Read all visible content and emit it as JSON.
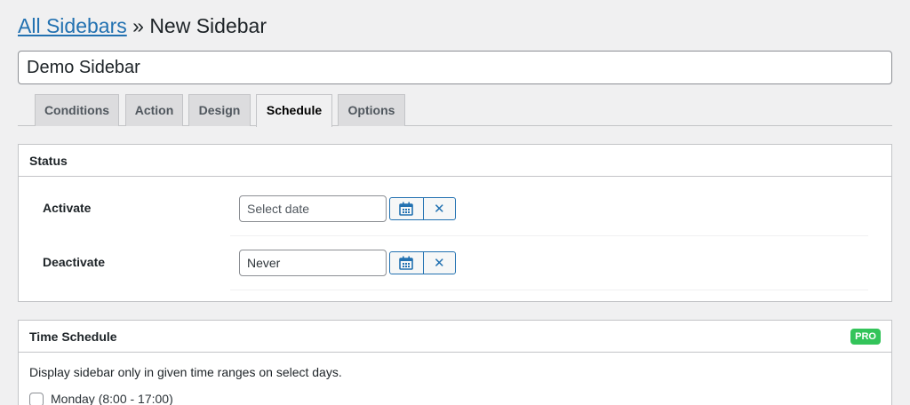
{
  "breadcrumb": {
    "link_label": "All Sidebars",
    "separator": "»",
    "current": "New Sidebar"
  },
  "title_input": {
    "value": "Demo Sidebar"
  },
  "tabs": [
    {
      "label": "Conditions",
      "active": false
    },
    {
      "label": "Action",
      "active": false
    },
    {
      "label": "Design",
      "active": false
    },
    {
      "label": "Schedule",
      "active": true
    },
    {
      "label": "Options",
      "active": false
    }
  ],
  "status_panel": {
    "title": "Status",
    "rows": [
      {
        "label": "Activate",
        "input_value": "",
        "placeholder": "Select date"
      },
      {
        "label": "Deactivate",
        "input_value": "Never",
        "placeholder": ""
      }
    ],
    "icons": {
      "calendar": "calendar-icon",
      "clear": "close-icon"
    },
    "clear_glyph": "✕"
  },
  "time_schedule_panel": {
    "title": "Time Schedule",
    "badge": "PRO",
    "description": "Display sidebar only in given time ranges on select days.",
    "days": [
      {
        "label": "Monday (8:00 - 17:00)",
        "checked": false
      }
    ]
  },
  "colors": {
    "accent": "#2271b1",
    "pro_badge": "#33c45a",
    "background": "#f0f0f1"
  }
}
